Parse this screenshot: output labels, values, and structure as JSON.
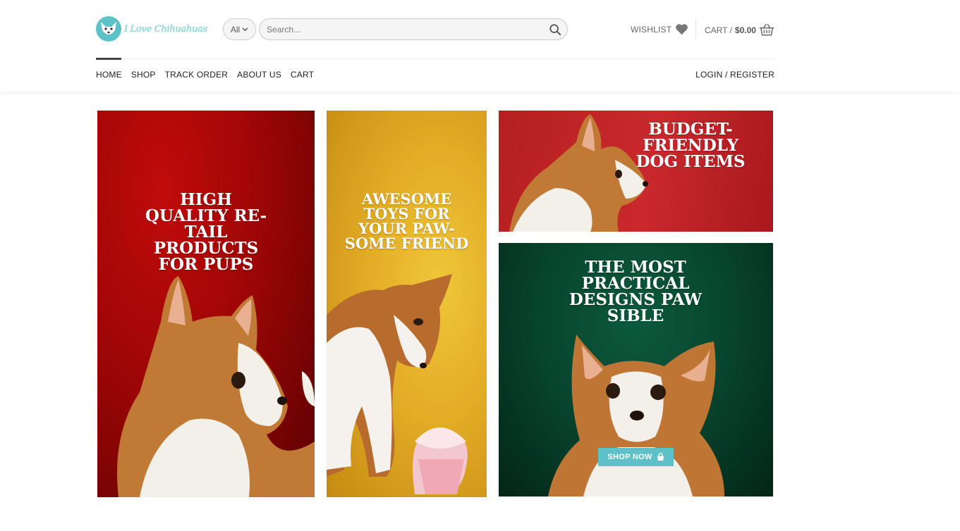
{
  "header": {
    "logo_text": "I Love Chihuahuas",
    "category_select": "All",
    "search_placeholder": "Search...",
    "wishlist_label": "WISHLIST",
    "cart_label": "CART /",
    "cart_total": "$0.00",
    "accent_color": "#5cc2c7"
  },
  "nav": {
    "items": [
      "HOME",
      "SHOP",
      "TRACK ORDER",
      "ABOUT US",
      "CART"
    ],
    "active": "HOME",
    "login_label": "LOGIN / REGISTER"
  },
  "banners": [
    {
      "title": "HIGH QUALITY RE-TAIL PRODUCTS FOR PUPS",
      "color": "#9e0606"
    },
    {
      "title": "AWESOME TOYS FOR YOUR PAW-SOME FRIEND",
      "color": "#e2ac25"
    },
    {
      "title": "BUDGET-FRIENDLY DOG ITEMS",
      "color": "#c9292c"
    },
    {
      "title": "THE MOST PRACTICAL DESIGNS PAW SIBLE",
      "color": "#07442e",
      "button_label": "SHOP NOW"
    }
  ],
  "icons": [
    "search-icon",
    "heart-icon",
    "basket-icon",
    "chevron-down-icon",
    "bag-icon"
  ]
}
